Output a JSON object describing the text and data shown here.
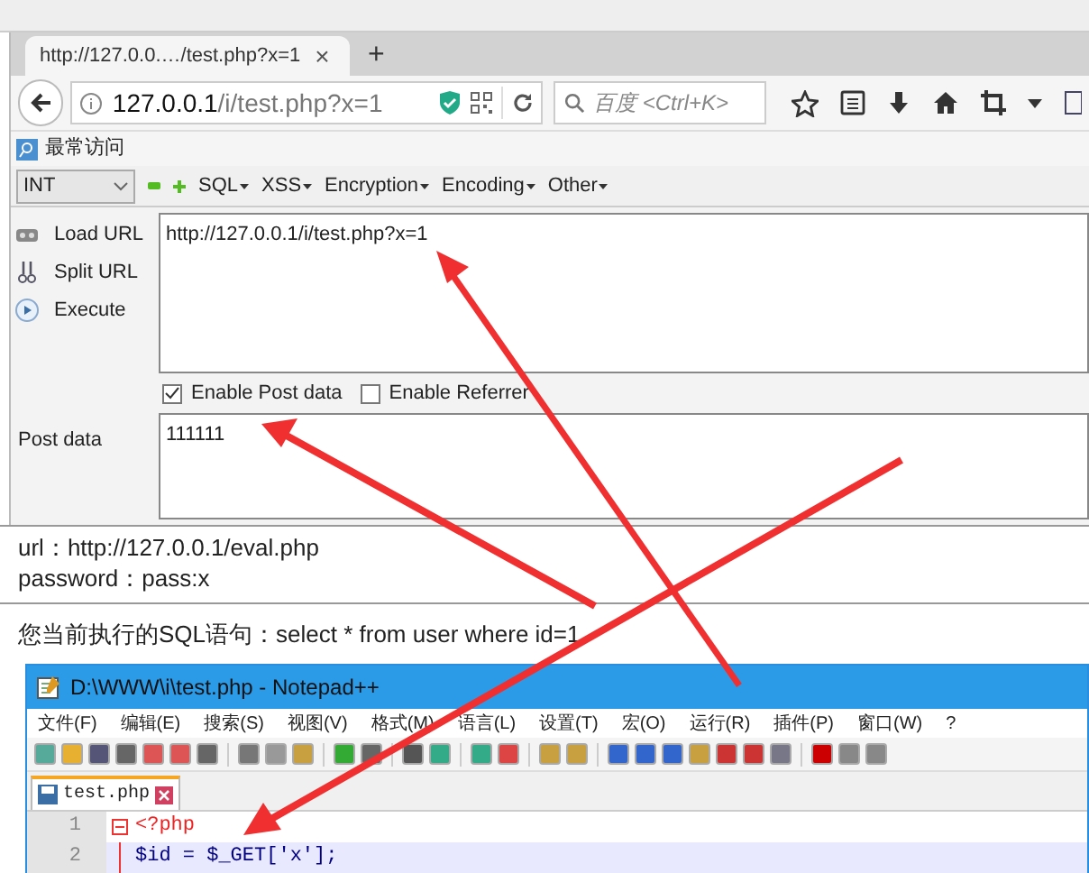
{
  "browser": {
    "tab": {
      "title": "http://127.0.0.…/test.php?x=1",
      "close": "×"
    },
    "new_tab": "+",
    "address": {
      "host": "127.0.0.1",
      "path": "/i/test.php?x=1"
    },
    "search": {
      "placeholder": "百度 <Ctrl+K>"
    },
    "bookmarks": [
      "最常访问"
    ]
  },
  "hackbar": {
    "select": "INT",
    "menus": [
      "SQL",
      "XSS",
      "Encryption",
      "Encoding",
      "Other"
    ],
    "actions": [
      "Load URL",
      "Split URL",
      "Execute"
    ],
    "url": "http://127.0.0.1/i/test.php?x=1",
    "options": [
      {
        "label": "Enable Post data",
        "checked": true
      },
      {
        "label": "Enable Referrer",
        "checked": false
      }
    ],
    "post_label": "Post data",
    "post_value": "111111"
  },
  "page": {
    "lines": [
      "url：http://127.0.0.1/eval.php",
      "password：pass:x"
    ],
    "sql": "您当前执行的SQL语句：select * from user where id=1"
  },
  "notepad": {
    "title": "D:\\WWW\\i\\test.php - Notepad++",
    "menu": [
      "文件(F)",
      "编辑(E)",
      "搜索(S)",
      "视图(V)",
      "格式(M)",
      "语言(L)",
      "设置(T)",
      "宏(O)",
      "运行(R)",
      "插件(P)",
      "窗口(W)",
      "?"
    ],
    "tab": "test.php",
    "lines": [
      {
        "number": "1",
        "text": "<?php",
        "kind": "tag",
        "current": false
      },
      {
        "number": "2",
        "text": "$id = $_GET['x'];",
        "kind": "code",
        "current": true
      }
    ]
  }
}
